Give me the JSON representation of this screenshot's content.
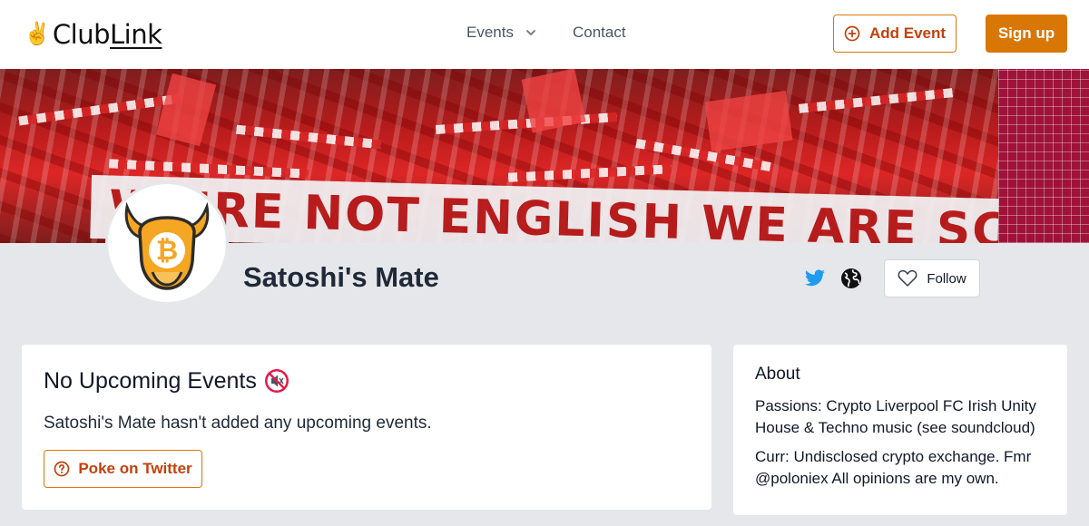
{
  "header": {
    "logo_text": "ClubLink",
    "logo_prefix": "Club",
    "logo_suffix": "Link",
    "nav": {
      "events_label": "Events",
      "contact_label": "Contact"
    },
    "add_event_label": "Add Event",
    "signup_label": "Sign up"
  },
  "banner": {
    "sign_text": "WE'RE NOT ENGLISH WE ARE SCOUSE"
  },
  "profile": {
    "name": "Satoshi's Mate",
    "follow_label": "Follow"
  },
  "events_card": {
    "title": "No Upcoming Events",
    "description": "Satoshi's Mate hasn't added any upcoming events.",
    "poke_label": "Poke on Twitter"
  },
  "about_card": {
    "title": "About",
    "paragraphs": [
      "Passions: Crypto Liverpool FC Irish Unity House & Techno music (see soundcloud)",
      "Curr: Undisclosed crypto exchange. Fmr @poloniex All opinions are my own."
    ]
  },
  "colors": {
    "accent": "#d97706",
    "accent_text": "#c2410c",
    "twitter": "#1d9bf0",
    "background": "#e5e7eb"
  },
  "icons": [
    "victory-hand-icon",
    "chevron-down-icon",
    "plus-circle-icon",
    "twitter-icon",
    "globe-icon",
    "heart-icon",
    "muted-speaker-icon",
    "question-circle-icon",
    "bitcoin-bull-icon"
  ]
}
